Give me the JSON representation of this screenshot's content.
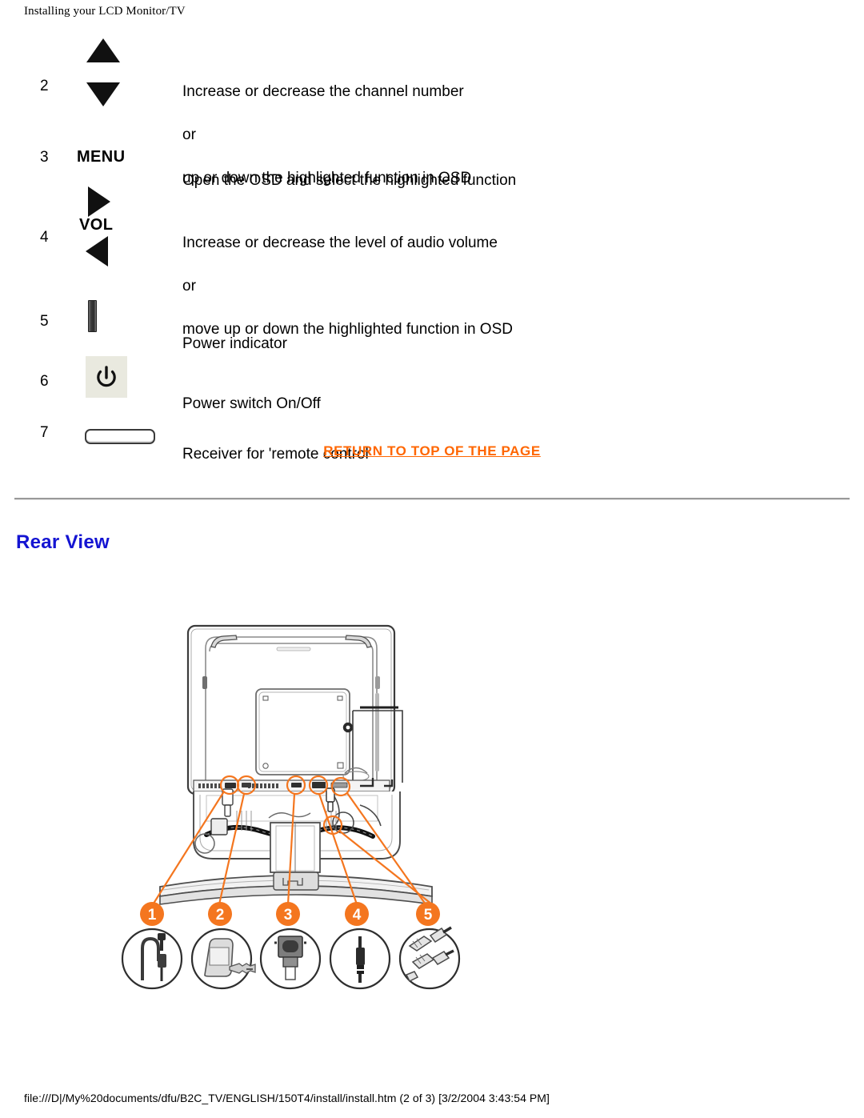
{
  "page": {
    "header": "Installing your LCD Monitor/TV",
    "footer": "file:///D|/My%20documents/dfu/B2C_TV/ENGLISH/150T4/install/install.htm (2 of 3) [3/2/2004 3:43:54 PM]"
  },
  "colors": {
    "link_orange": "#ff6600",
    "callout_orange": "#f4761f",
    "heading_blue": "#1414d2",
    "rule_gray": "#999999",
    "switch_bg": "#e9e9df"
  },
  "controls": [
    {
      "num": "2",
      "icon": "up-down-triangle-icon",
      "label": "",
      "desc_lines": [
        "Increase or decrease the channel number",
        "or",
        "up or down the highlighted function in OSD"
      ]
    },
    {
      "num": "3",
      "icon": "menu-button-icon",
      "label": "MENU",
      "desc_lines": [
        "Open the OSD and select the highlighted function"
      ]
    },
    {
      "num": "4",
      "icon": "volume-arrows-icon",
      "label": "VOL",
      "desc_lines": [
        "Increase or decrease the level of audio volume",
        "or",
        "move up or down the highlighted function in OSD"
      ]
    },
    {
      "num": "5",
      "icon": "power-indicator-icon",
      "label": "",
      "desc_lines": [
        "Power indicator"
      ]
    },
    {
      "num": "6",
      "icon": "power-switch-icon",
      "label": "",
      "desc_lines": [
        "Power switch On/Off"
      ]
    },
    {
      "num": "7",
      "icon": "ir-receiver-icon",
      "label": "",
      "desc_lines": [
        "Receiver for 'remote control'"
      ]
    }
  ],
  "return_link": {
    "label": "RETURN TO TOP OF THE PAGE"
  },
  "section": {
    "title": "Rear View"
  },
  "figure": {
    "name": "rear-view-diagram",
    "callouts": [
      {
        "num": "1",
        "connector": "power-cable-icon"
      },
      {
        "num": "2",
        "connector": "antenna-connector-icon"
      },
      {
        "num": "3",
        "connector": "vga-connector-icon"
      },
      {
        "num": "4",
        "connector": "audio-jack-icon"
      },
      {
        "num": "5",
        "connector": "av-jacks-icon"
      }
    ]
  }
}
